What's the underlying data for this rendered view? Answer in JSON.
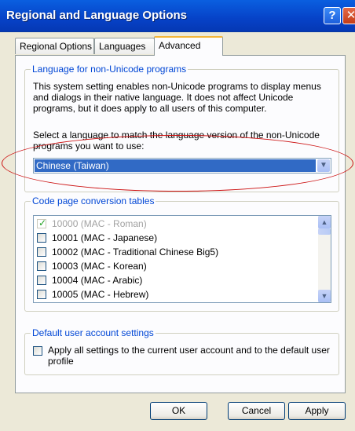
{
  "window": {
    "title": "Regional and Language Options",
    "help_glyph": "?",
    "close_glyph": "✕"
  },
  "tabs": [
    {
      "label": "Regional Options",
      "active": false
    },
    {
      "label": "Languages",
      "active": false
    },
    {
      "label": "Advanced",
      "active": true
    }
  ],
  "language_group": {
    "title": "Language for non-Unicode programs",
    "description": "This system setting enables non-Unicode programs to display menus and dialogs in their native language. It does not affect Unicode programs, but it does apply to all users of this computer.",
    "prompt": "Select a language to match the language version of the non-Unicode programs you want to use:",
    "selected_language": "Chinese (Taiwan)"
  },
  "codepage_group": {
    "title": "Code page conversion tables",
    "items": [
      {
        "label": "10000 (MAC - Roman)",
        "checked": true,
        "disabled": true
      },
      {
        "label": "10001 (MAC - Japanese)",
        "checked": false,
        "disabled": false
      },
      {
        "label": "10002 (MAC - Traditional Chinese Big5)",
        "checked": false,
        "disabled": false
      },
      {
        "label": "10003 (MAC - Korean)",
        "checked": false,
        "disabled": false
      },
      {
        "label": "10004 (MAC - Arabic)",
        "checked": false,
        "disabled": false
      },
      {
        "label": "10005 (MAC - Hebrew)",
        "checked": false,
        "disabled": false
      }
    ]
  },
  "default_group": {
    "title": "Default user account settings",
    "checkbox_label": "Apply all settings to the current user account and to the default user profile",
    "checked": false
  },
  "buttons": {
    "ok": "OK",
    "cancel": "Cancel",
    "apply": "Apply"
  },
  "colors": {
    "titlebar": "#0642c7",
    "group_title": "#0046d5",
    "selection": "#316ac5",
    "annotation": "#cc1111"
  }
}
